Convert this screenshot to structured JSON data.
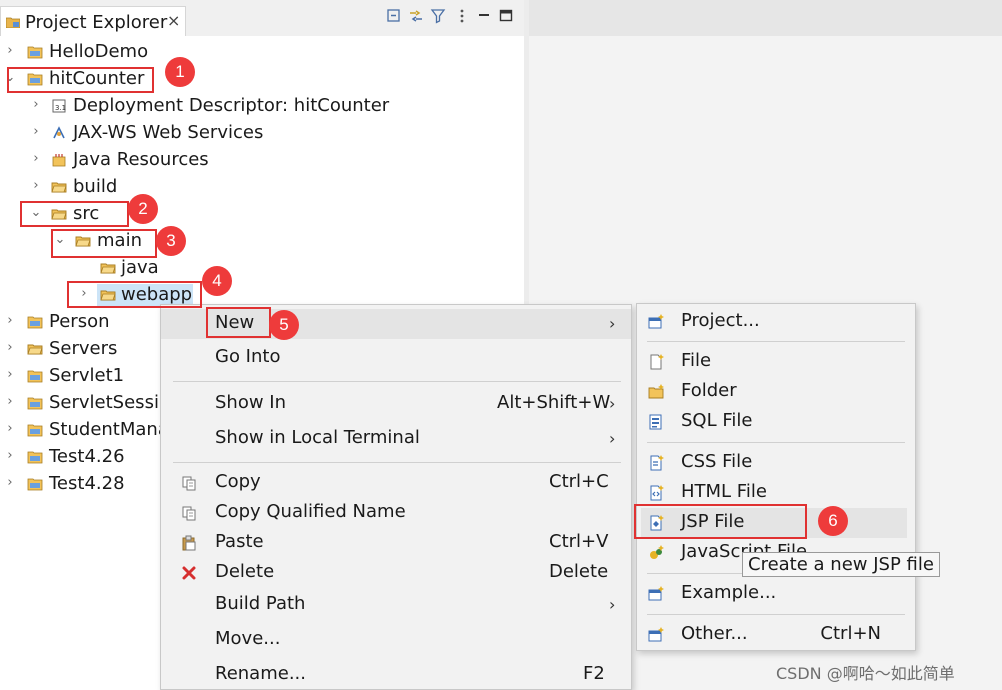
{
  "explorer": {
    "title": "Project Explorer",
    "close": "×",
    "tree": [
      {
        "label": "HelloDemo",
        "expanded": false
      },
      {
        "label": "hitCounter",
        "expanded": true
      },
      {
        "label": "Deployment Descriptor: hitCounter",
        "expanded": false
      },
      {
        "label": "JAX-WS Web Services",
        "expanded": false
      },
      {
        "label": "Java Resources",
        "expanded": false
      },
      {
        "label": "build",
        "expanded": false
      },
      {
        "label": "src",
        "expanded": true
      },
      {
        "label": "main",
        "expanded": true
      },
      {
        "label": "java"
      },
      {
        "label": "webapp",
        "expanded": false,
        "selected": true
      },
      {
        "label": "Person",
        "expanded": false
      },
      {
        "label": "Servers",
        "expanded": false
      },
      {
        "label": "Servlet1",
        "expanded": false
      },
      {
        "label": "ServletSession",
        "expanded": false
      },
      {
        "label": "StudentManager",
        "expanded": false
      },
      {
        "label": "Test4.26",
        "expanded": false
      },
      {
        "label": "Test4.28",
        "expanded": false
      }
    ]
  },
  "annotations": [
    "1",
    "2",
    "3",
    "4",
    "5",
    "6"
  ],
  "context_menu": {
    "items": [
      {
        "label": "New",
        "submenu": true
      },
      {
        "label": "Go Into"
      },
      {
        "label": "Show In",
        "accel": "Alt+Shift+W",
        "submenu": true
      },
      {
        "label": "Show in Local Terminal",
        "submenu": true
      },
      {
        "label": "Copy",
        "accel": "Ctrl+C"
      },
      {
        "label": "Copy Qualified Name"
      },
      {
        "label": "Paste",
        "accel": "Ctrl+V"
      },
      {
        "label": "Delete",
        "accel": "Delete"
      },
      {
        "label": "Build Path",
        "submenu": true
      },
      {
        "label": "Move..."
      },
      {
        "label": "Rename...",
        "accel": "F2"
      }
    ]
  },
  "submenu": {
    "items": [
      {
        "label": "Project..."
      },
      {
        "label": "File"
      },
      {
        "label": "Folder"
      },
      {
        "label": "SQL File"
      },
      {
        "label": "CSS File"
      },
      {
        "label": "HTML File"
      },
      {
        "label": "JSP File"
      },
      {
        "label": "JavaScript File"
      },
      {
        "label": "Example..."
      },
      {
        "label": "Other...",
        "accel": "Ctrl+N"
      }
    ]
  },
  "tooltip": "Create a new JSP file",
  "watermark": "CSDN @啊哈～如此简单",
  "colors": {
    "annotation_red": "#e03131",
    "selection": "#cce4f7",
    "folder": "#e8b44c"
  }
}
